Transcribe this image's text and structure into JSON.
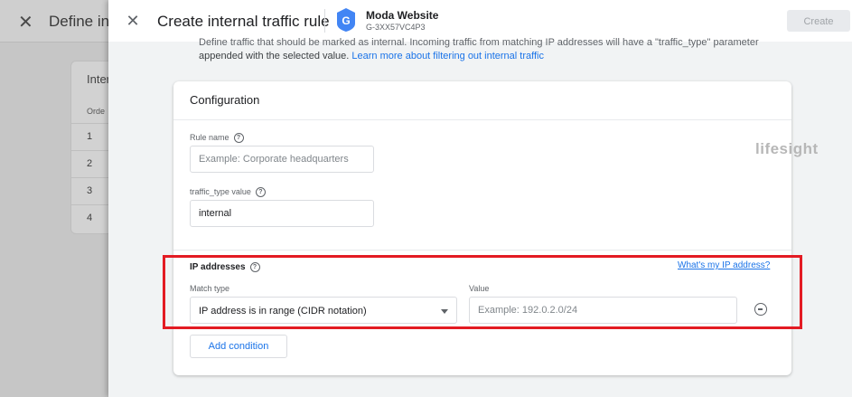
{
  "background": {
    "title": "Define inte",
    "card_title": "Inter",
    "column_header": "Orde",
    "rows": [
      "1",
      "2",
      "3",
      "4"
    ]
  },
  "header": {
    "title": "Create internal traffic rule",
    "property_name": "Moda Website",
    "property_id": "G-3XX57VC4P3",
    "create_label": "Create"
  },
  "intro": {
    "line1": "Define traffic that should be marked as internal. Incoming traffic from matching IP addresses will have a \"traffic_type\" parameter",
    "line2_text": "appended with the selected value.",
    "line2_link": "Learn more about filtering out internal traffic"
  },
  "config": {
    "title": "Configuration",
    "rule_name_label": "Rule name",
    "rule_name_placeholder": "Example: Corporate headquarters",
    "traffic_type_label": "traffic_type value",
    "traffic_type_value": "internal",
    "ip_title": "IP addresses",
    "ip_link": "What's my IP address?",
    "match_type_label": "Match type",
    "match_type_value": "IP address is in range (CIDR notation)",
    "value_label": "Value",
    "value_placeholder": "Example: 192.0.2.0/24",
    "add_condition_label": "Add condition"
  },
  "watermark": "lifesight",
  "colors": {
    "accent": "#1a73e8",
    "highlight": "#e31b23"
  },
  "icons": {
    "close": "close-icon",
    "property": "analytics-property-icon",
    "help": "help-icon",
    "dropdown": "chevron-down-icon",
    "remove": "remove-circle-icon"
  }
}
